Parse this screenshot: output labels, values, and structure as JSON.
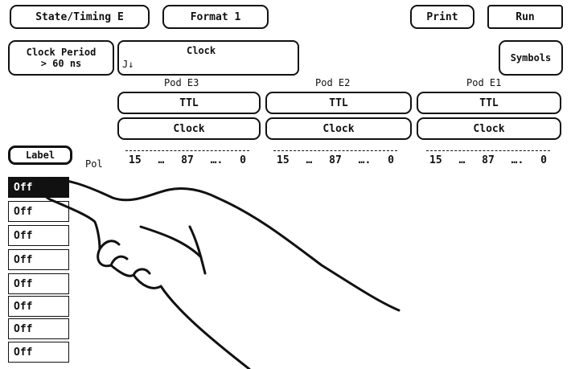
{
  "toolbar": {
    "menu": "State/Timing E",
    "format": "Format 1",
    "print": "Print",
    "run": "Run"
  },
  "clock_period": {
    "line1": "Clock Period",
    "line2": "> 60 ns"
  },
  "clock": {
    "title": "Clock",
    "value": "J↓"
  },
  "symbols": "Symbols",
  "pods": [
    {
      "name": "Pod E3",
      "threshold": "TTL",
      "mode": "Clock"
    },
    {
      "name": "Pod E2",
      "threshold": "TTL",
      "mode": "Clock"
    },
    {
      "name": "Pod E1",
      "threshold": "TTL",
      "mode": "Clock"
    }
  ],
  "label_button": "Label",
  "pol_label": "Pol",
  "bit_ranges": [
    {
      "high": "15",
      "mid": "87",
      "low": "0"
    },
    {
      "high": "15",
      "mid": "87",
      "low": "0"
    },
    {
      "high": "15",
      "mid": "87",
      "low": "0"
    }
  ],
  "label_rows": [
    "Off",
    "Off",
    "Off",
    "Off",
    "Off",
    "Off",
    "Off",
    "Off"
  ]
}
